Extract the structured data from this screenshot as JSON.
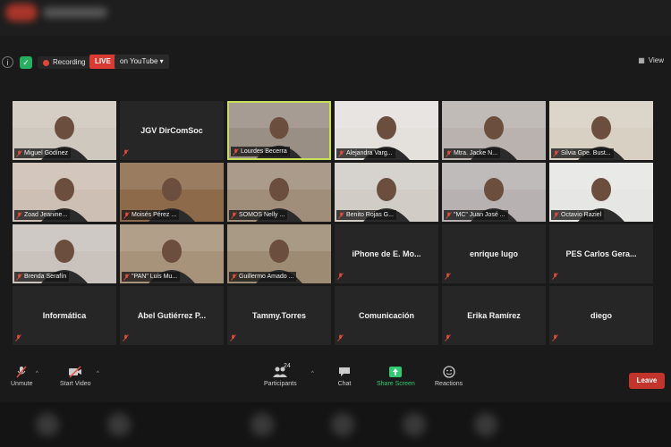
{
  "header": {
    "recording_label": "Recording",
    "live_label": "LIVE",
    "stream_label": "on YouTube",
    "view_label": "View"
  },
  "participants": [
    {
      "name": "Miguel Godínez",
      "video": true
    },
    {
      "name": "JGV DirComSoc",
      "video": false
    },
    {
      "name": "Lourdes Becerra",
      "video": true,
      "active": true
    },
    {
      "name": "Alejandra Varg...",
      "video": true
    },
    {
      "name": "Mtra. Jacke N...",
      "video": true
    },
    {
      "name": "Silvia Gpe. Bust...",
      "video": true
    },
    {
      "name": "Zoad Jeanine...",
      "video": true
    },
    {
      "name": "Moisés Pérez ...",
      "video": true
    },
    {
      "name": "SOMOS Nelly ...",
      "video": true
    },
    {
      "name": "Benito Rojas G...",
      "video": true
    },
    {
      "name": "\"MC\" Juan José ...",
      "video": true
    },
    {
      "name": "Octavio Raziel",
      "video": true
    },
    {
      "name": "Brenda Serafín",
      "video": true
    },
    {
      "name": "\"PAN\" Luis Mu...",
      "video": true
    },
    {
      "name": "Guillermo Amado ...",
      "video": true
    },
    {
      "name": "iPhone de E. Mo...",
      "video": false
    },
    {
      "name": "enrique lugo",
      "video": false
    },
    {
      "name": "PES Carlos Gera...",
      "video": false
    },
    {
      "name": "Informática",
      "video": false
    },
    {
      "name": "Abel Gutiérrez P...",
      "video": false
    },
    {
      "name": "Tammy.Torres",
      "video": false
    },
    {
      "name": "Comunicación",
      "video": false
    },
    {
      "name": "Erika Ramírez",
      "video": false
    },
    {
      "name": "diego",
      "video": false
    }
  ],
  "toolbar": {
    "unmute": "Unmute",
    "start_video": "Start Video",
    "participants": "Participants",
    "participants_count": "24",
    "chat": "Chat",
    "share_screen": "Share Screen",
    "reactions": "Reactions",
    "leave": "Leave"
  },
  "colors": {
    "live": "#d93b32",
    "active_border": "#c8df5a",
    "share_green": "#2ecc71",
    "leave": "#c3342c",
    "muted_red": "#e74c3c"
  }
}
